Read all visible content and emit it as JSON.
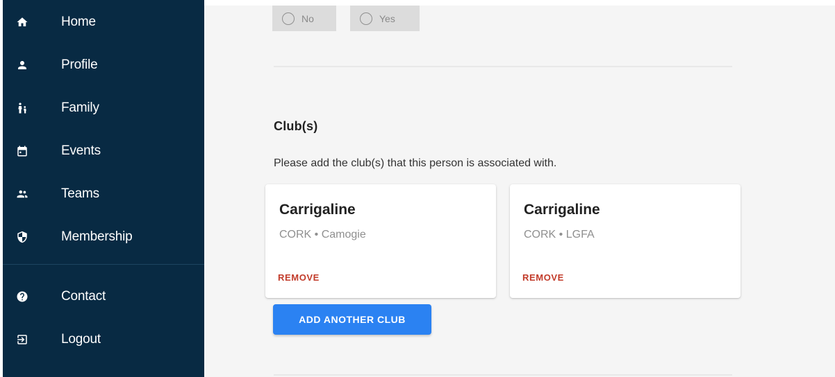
{
  "sidebar": {
    "items": [
      {
        "label": "Home",
        "icon": "home-icon"
      },
      {
        "label": "Profile",
        "icon": "person-icon"
      },
      {
        "label": "Family",
        "icon": "family-icon"
      },
      {
        "label": "Events",
        "icon": "calendar-icon"
      },
      {
        "label": "Teams",
        "icon": "group-icon"
      },
      {
        "label": "Membership",
        "icon": "shield-icon"
      },
      {
        "label": "Contact",
        "icon": "help-icon"
      },
      {
        "label": "Logout",
        "icon": "logout-icon"
      }
    ]
  },
  "radio": {
    "options": [
      {
        "label": "No"
      },
      {
        "label": "Yes"
      }
    ]
  },
  "clubs": {
    "title": "Club(s)",
    "description": "Please add the club(s) that this person is associated with.",
    "cards": [
      {
        "name": "Carrigaline",
        "details": "CORK • Camogie",
        "remove_label": "REMOVE"
      },
      {
        "name": "Carrigaline",
        "details": "CORK • LGFA",
        "remove_label": "REMOVE"
      }
    ],
    "add_button_label": "ADD ANOTHER CLUB"
  },
  "colors": {
    "sidebar_bg": "#082a43",
    "accent": "#2b82f2",
    "remove": "#c23b2a"
  }
}
